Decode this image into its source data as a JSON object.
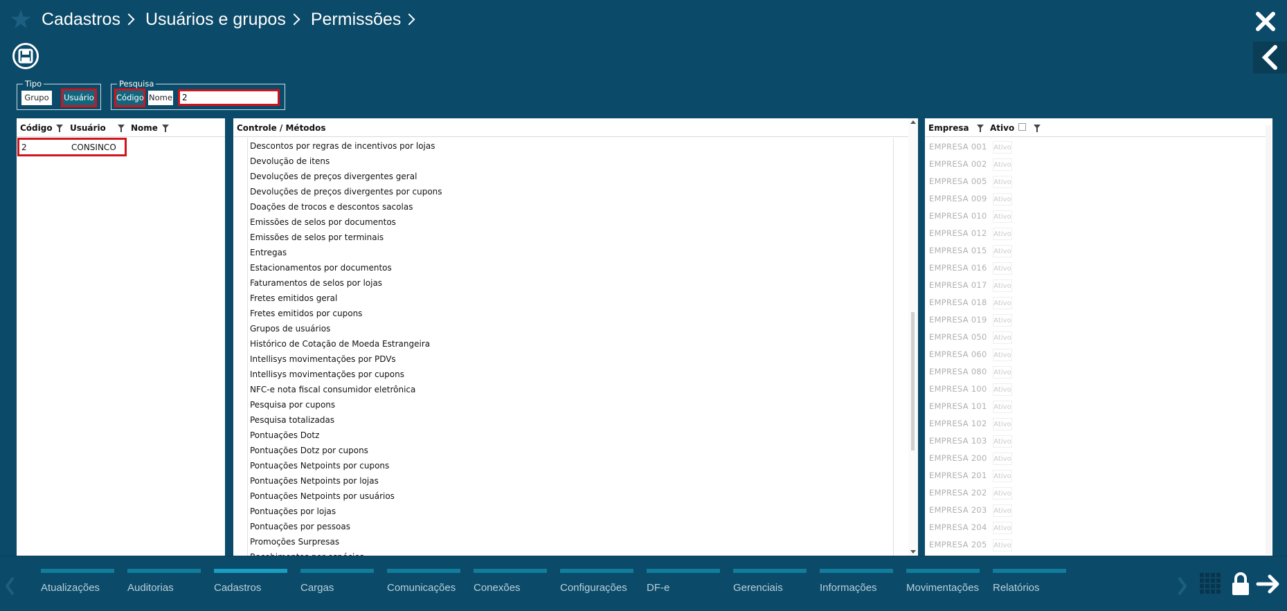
{
  "header": {
    "breadcrumb": [
      "Cadastros",
      "Usuários e grupos",
      "Permissões"
    ]
  },
  "tipo": {
    "title": "Tipo",
    "grupo_label": "Grupo",
    "usuario_label": "Usuário"
  },
  "pesquisa": {
    "title": "Pesquisa",
    "codigo_label": "Código",
    "nome_label": "Nome",
    "value": "2"
  },
  "users": {
    "columns": [
      "Código",
      "Usuário",
      "Nome"
    ],
    "rows": [
      {
        "codigo": "2",
        "usuario": "CONSINCO",
        "nome": ""
      }
    ]
  },
  "methods": {
    "header": "Controle / Métodos",
    "items": [
      "Descontos por regras de incentivos por lojas",
      "Devolução de itens",
      "Devoluções de preços divergentes geral",
      "Devoluções de preços divergentes por cupons",
      "Doações de trocos e descontos sacolas",
      "Emissões de selos por documentos",
      "Emissões de selos por terminais",
      "Entregas",
      "Estacionamentos por documentos",
      "Faturamentos de selos por lojas",
      "Fretes emitidos geral",
      "Fretes emitidos por cupons",
      "Grupos de usuários",
      "Histórico de Cotação de Moeda Estrangeira",
      "Intellisys movimentações por PDVs",
      "Intellisys movimentações por cupons",
      "NFC-e nota fiscal consumidor eletrônica",
      "Pesquisa por cupons",
      "Pesquisa totalizadas",
      "Pontuações Dotz",
      "Pontuações Dotz por cupons",
      "Pontuações Netpoints por cupons",
      "Pontuações Netpoints por lojas",
      "Pontuações Netpoints por usuários",
      "Pontuações por lojas",
      "Pontuações por pessoas",
      "Promoções Surpresas",
      "Recebimentos por espécies"
    ]
  },
  "empresas": {
    "columns": [
      "Empresa",
      "Ativo"
    ],
    "ativo_label": "Ativo",
    "rows": [
      "EMPRESA 001",
      "EMPRESA 002",
      "EMPRESA 005",
      "EMPRESA 009",
      "EMPRESA 010",
      "EMPRESA 012",
      "EMPRESA 015",
      "EMPRESA 016",
      "EMPRESA 017",
      "EMPRESA 018",
      "EMPRESA 019",
      "EMPRESA 050",
      "EMPRESA 060",
      "EMPRESA 080",
      "EMPRESA 100",
      "EMPRESA 101",
      "EMPRESA 102",
      "EMPRESA 103",
      "EMPRESA 200",
      "EMPRESA 201",
      "EMPRESA 202",
      "EMPRESA 203",
      "EMPRESA 204",
      "EMPRESA 205"
    ]
  },
  "bottom_menu": {
    "items": [
      "Atualizações",
      "Auditorias",
      "Cadastros",
      "Cargas",
      "Comunicações",
      "Conexões",
      "Configurações",
      "DF-e",
      "Gerenciais",
      "Informações",
      "Movimentações",
      "Relatórios"
    ],
    "active": "Cadastros"
  },
  "colors": {
    "background": "#0b4a68",
    "highlight": "#d0141b",
    "teal_button": "#11667f"
  }
}
